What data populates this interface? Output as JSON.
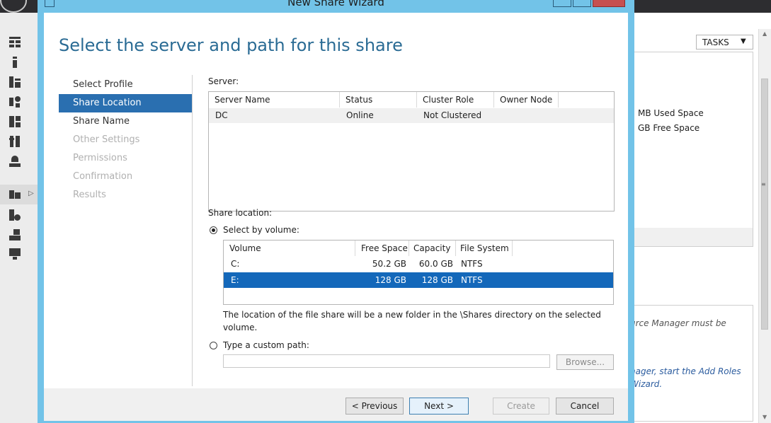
{
  "wizard": {
    "window_title": "New Share Wizard",
    "heading": "Select the server and path for this share",
    "steps": [
      {
        "label": "Select Profile",
        "state": "normal"
      },
      {
        "label": "Share Location",
        "state": "active"
      },
      {
        "label": "Share Name",
        "state": "normal"
      },
      {
        "label": "Other Settings",
        "state": "disabled"
      },
      {
        "label": "Permissions",
        "state": "disabled"
      },
      {
        "label": "Confirmation",
        "state": "disabled"
      },
      {
        "label": "Results",
        "state": "disabled"
      }
    ],
    "server": {
      "label": "Server:",
      "columns": [
        "Server Name",
        "Status",
        "Cluster Role",
        "Owner Node"
      ],
      "rows": [
        {
          "server_name": "DC",
          "status": "Online",
          "cluster_role": "Not Clustered",
          "owner_node": ""
        }
      ]
    },
    "share_location": {
      "label": "Share location:",
      "by_volume_label": "Select by volume:",
      "by_volume_selected": true,
      "volume_columns": [
        "Volume",
        "Free Space",
        "Capacity",
        "File System"
      ],
      "volumes": [
        {
          "volume": "C:",
          "free_space": "50.2 GB",
          "capacity": "60.0 GB",
          "file_system": "NTFS",
          "selected": false
        },
        {
          "volume": "E:",
          "free_space": "128 GB",
          "capacity": "128 GB",
          "file_system": "NTFS",
          "selected": true
        }
      ],
      "note": "The location of the file share will be a new folder in the \\Shares directory on the selected volume.",
      "custom_path_label": "Type a custom path:",
      "custom_path_selected": false,
      "custom_path_value": "",
      "browse_label": "Browse..."
    },
    "buttons": {
      "previous": "< Previous",
      "next": "Next >",
      "create": "Create",
      "cancel": "Cancel"
    }
  },
  "background": {
    "tasks_label": "TASKS",
    "tasks_chevron": "▼",
    "used_space_text": "MB Used Space",
    "free_space_text": "GB Free Space",
    "notice_line1": "urce Manager must be",
    "notice_line2": "nager, start the Add Roles",
    "notice_line3": "Wizard."
  },
  "colors": {
    "accent_blue": "#2a6fb0",
    "selection_blue": "#1468ba",
    "window_frame": "#72c3e8",
    "heading_blue": "#2a6b94",
    "close_red": "#c75050"
  }
}
